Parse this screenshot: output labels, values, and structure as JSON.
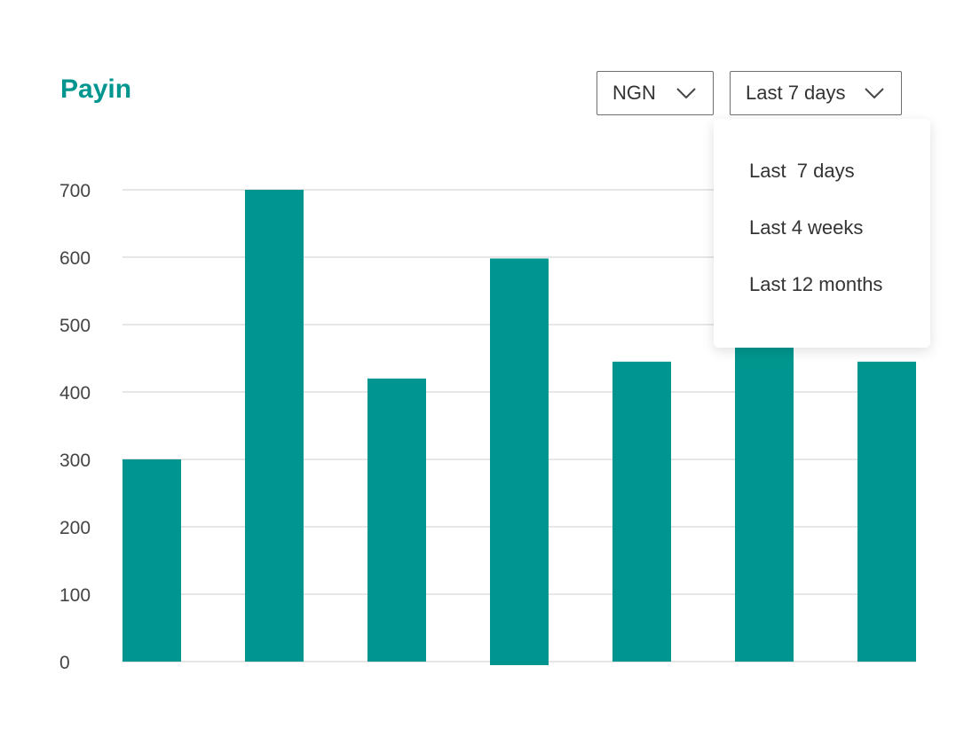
{
  "header": {
    "title": "Payin",
    "currency_select": {
      "value": "NGN",
      "icon": "chevron-down-icon"
    },
    "range_select": {
      "value": "Last 7 days",
      "icon": "chevron-down-icon"
    }
  },
  "dropdown": {
    "items": [
      "Last  7 days",
      "Last 4 weeks",
      "Last 12 months"
    ]
  },
  "colors": {
    "accent": "#00968f",
    "grid": "#e6e6e6"
  },
  "chart_data": {
    "type": "bar",
    "title": "Payin",
    "categories": [
      "",
      "",
      "",
      "",
      "",
      "",
      ""
    ],
    "values": [
      300,
      700,
      420,
      598,
      445,
      470,
      445
    ],
    "yticks": [
      0,
      100,
      200,
      300,
      400,
      500,
      600,
      700
    ],
    "ylim": [
      0,
      700
    ],
    "grid": true,
    "color": "#00968f"
  }
}
